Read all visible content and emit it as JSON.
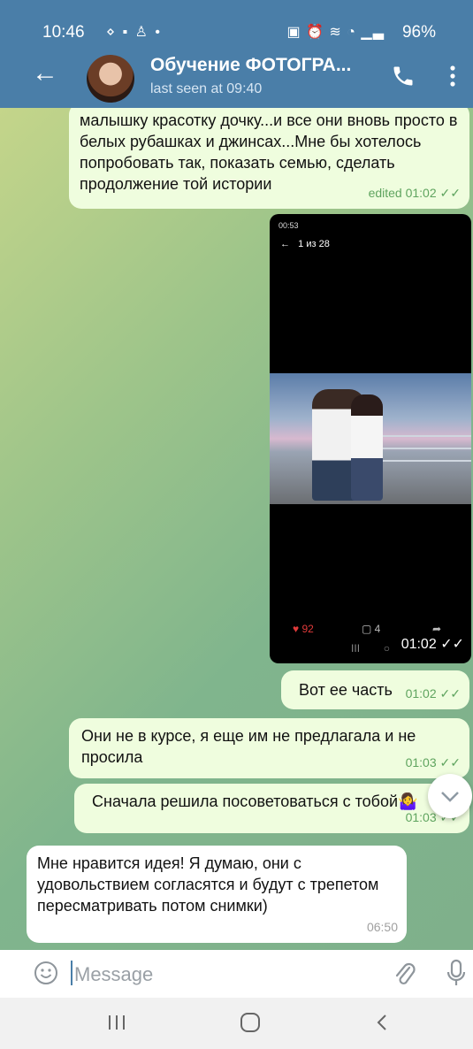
{
  "status": {
    "time": "10:46",
    "battery": "96%"
  },
  "header": {
    "title": "Обучение ФОТОГРА...",
    "subtitle": "last seen at 09:40"
  },
  "messages": [
    {
      "type": "out",
      "text": "малышку красотку дочку...и все они вновь просто в белых рубашках и джинсах...Мне бы хотелось попробовать так, показать семью, сделать продолжение той истории",
      "meta": "edited 01:02"
    },
    {
      "type": "photo",
      "status": "00:53",
      "counter": "1 из 28",
      "likes": "92",
      "comments": "4",
      "meta": "01:02"
    },
    {
      "type": "out",
      "text": "Вот ее часть",
      "meta": "01:02"
    },
    {
      "type": "out",
      "text": "Они не в курсе, я еще им не предлагала и не просила",
      "meta": "01:03"
    },
    {
      "type": "out",
      "text": "Сначала решила посоветоваться с тобой🤷‍♀️",
      "meta": "01:03"
    },
    {
      "type": "in",
      "text": "Мне нравится идея! Я думаю, они с удовольствием согласятся и будут с трепетом пересматривать потом снимки)",
      "meta": "06:50"
    }
  ],
  "input": {
    "placeholder": "Message"
  },
  "colors": {
    "header": "#4a7ea8",
    "outgoing": "#effdde",
    "incoming": "#ffffff",
    "check": "#5fa45f"
  },
  "icons": [
    "back-arrow-icon",
    "phone-icon",
    "more-vert-icon",
    "double-check-icon",
    "chevron-down-icon",
    "emoji-icon",
    "attach-icon",
    "mic-icon",
    "recents-icon",
    "home-icon",
    "back-nav-icon"
  ]
}
